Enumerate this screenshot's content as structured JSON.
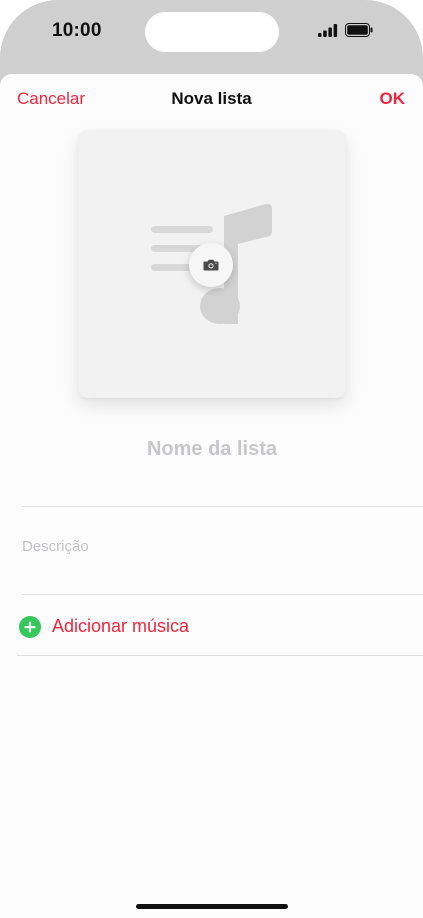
{
  "status_bar": {
    "time": "10:00",
    "icons": [
      "signal-icon",
      "battery-icon"
    ]
  },
  "nav": {
    "cancel_label": "Cancelar",
    "title": "Nova lista",
    "ok_label": "OK"
  },
  "artwork": {
    "icons": [
      "music-note-placeholder-icon",
      "camera-icon"
    ]
  },
  "form": {
    "name_placeholder": "Nome da lista",
    "description_placeholder": "Descrição"
  },
  "add_music": {
    "label": "Adicionar música",
    "icon": "plus-circle-icon"
  },
  "colors": {
    "accent": "#f0253e",
    "add_icon": "#34c759"
  }
}
